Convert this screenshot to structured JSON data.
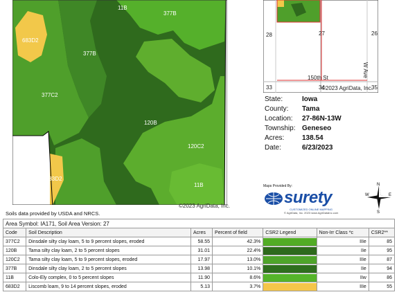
{
  "map": {
    "labels": [
      "11B",
      "377B",
      "683D2",
      "377B",
      "377C2",
      "120B",
      "120C2",
      "683D2",
      "11B"
    ],
    "copyright": "©2023 AgriData, Inc."
  },
  "inset": {
    "section_numbers": [
      "28",
      "27",
      "26",
      "33",
      "34",
      "35"
    ],
    "road_vertical": "W Ave",
    "road_horizontal": "150th St",
    "copyright": "©2023 AgriData, Inc."
  },
  "info": {
    "state_key": "State:",
    "state": "Iowa",
    "county_key": "County:",
    "county": "Tama",
    "location_key": "Location:",
    "location": "27-86N-13W",
    "township_key": "Township:",
    "township": "Geneseo",
    "acres_key": "Acres:",
    "acres": "138.54",
    "date_key": "Date:",
    "date": "6/23/2023"
  },
  "logo": {
    "provided_by": "Maps Provided By:",
    "brand": "surety",
    "tagline": "CUSTOMIZED ONLINE MAPPING",
    "footer": "© AgriData, Inc. 2023    www.AgriDataInc.com"
  },
  "compass": {
    "n": "N",
    "s": "S",
    "e": "E",
    "w": "W"
  },
  "table": {
    "note": "Soils data provided by USDA and NRCS.",
    "area_symbol": "Area Symbol: IA171, Soil Area Version: 27",
    "headers": [
      "Code",
      "Soil Description",
      "Acres",
      "Percent of field",
      "CSR2 Legend",
      "Non-Irr Class *c",
      "CSR2**"
    ],
    "rows": [
      {
        "code": "377C2",
        "desc": "Dinsdale silty clay loam, 5 to 9 percent slopes, eroded",
        "acres": "58.55",
        "pct": "42.3%",
        "legend_color": "#52ac25",
        "class": "IIIe",
        "csr2": "85"
      },
      {
        "code": "120B",
        "desc": "Tama silty clay loam, 2 to 5 percent slopes",
        "acres": "31.01",
        "pct": "22.4%",
        "legend_color": "#2e6a1c",
        "class": "IIe",
        "csr2": "95"
      },
      {
        "code": "120C2",
        "desc": "Tama silty clay loam, 5 to 9 percent slopes, eroded",
        "acres": "17.97",
        "pct": "13.0%",
        "legend_color": "#4fa42a",
        "class": "IIIe",
        "csr2": "87"
      },
      {
        "code": "377B",
        "desc": "Dinsdale silty clay loam, 2 to 5 percent slopes",
        "acres": "13.98",
        "pct": "10.1%",
        "legend_color": "#2f6e1e",
        "class": "IIe",
        "csr2": "94"
      },
      {
        "code": "11B",
        "desc": "Colo-Ely complex, 0 to 5 percent slopes",
        "acres": "11.90",
        "pct": "8.6%",
        "legend_color": "#55b42a",
        "class": "IIw",
        "csr2": "86"
      },
      {
        "code": "683D2",
        "desc": "Liscomb loam, 9 to 14 percent slopes, eroded",
        "acres": "5.13",
        "pct": "3.7%",
        "legend_color": "#f5c64a",
        "class": "IIIe",
        "csr2": "55"
      }
    ]
  },
  "colors": {
    "dark_green": "#2f6a1d",
    "mid_green": "#4f9f2b",
    "light_green": "#62b42f",
    "yellow": "#f2c84a",
    "boundary": "#e03030"
  }
}
